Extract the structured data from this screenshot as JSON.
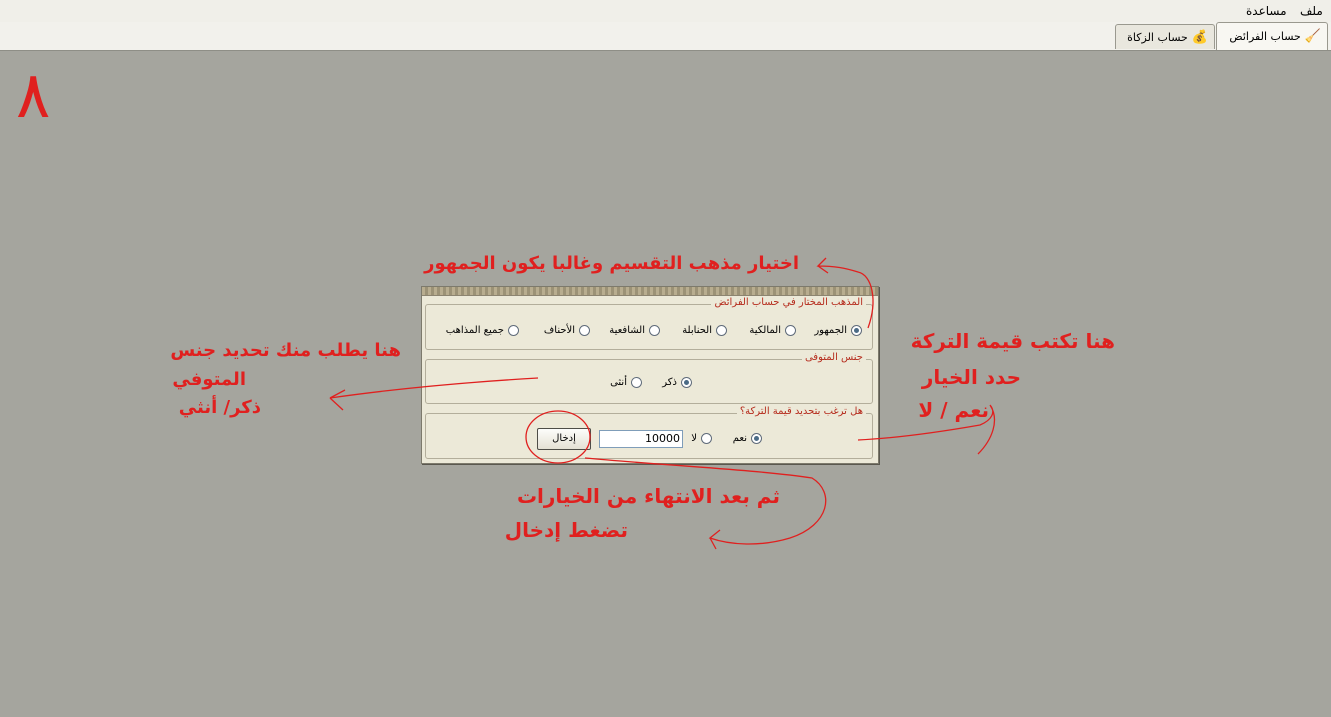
{
  "menu": {
    "file": "ملف",
    "help": "مساعدة"
  },
  "tabs": [
    {
      "label": "حساب الفرائض",
      "icon": "broom-icon",
      "active": true
    },
    {
      "label": "حساب الزكاة",
      "icon": "money-bag-icon",
      "active": false
    }
  ],
  "page_number": "٨",
  "dialog": {
    "madhhab": {
      "legend": "المذهب المختار في حساب الفرائض",
      "options": [
        "الجمهور",
        "المالكية",
        "الحنابلة",
        "الشافعية",
        "الأحناف",
        "جميع المذاهب"
      ],
      "selected": "الجمهور"
    },
    "gender": {
      "legend": "جنس المتوفى",
      "options": [
        "ذكر",
        "أنثى"
      ],
      "selected": "ذكر"
    },
    "estate": {
      "legend": "هل ترغب بتحديد قيمة التركة؟",
      "options": [
        "نعم",
        "لا"
      ],
      "selected": "نعم",
      "value": "10000",
      "enter_label": "إدخال"
    }
  },
  "annotations": {
    "madhhab_note": "اختيار مذهب التقسيم وغالبا يكون الجمهور",
    "gender_line1": "هنا يطلب منك تحديد جنس",
    "gender_line2": "المتوفي",
    "gender_line3": "ذكر/ أنثي",
    "estate_line1": "هنا تكتب قيمة التركة",
    "estate_line2": "حدد الخيار",
    "estate_line3": "نعم / لا",
    "finish_line1": "ثم  بعد الانتهاء من الخيارات",
    "finish_line2": "تضغط إدخال"
  },
  "colors": {
    "annotation": "#e0201f",
    "background": "#a5a59e",
    "dialog": "#ece9d8",
    "legend": "#b52b1c"
  }
}
